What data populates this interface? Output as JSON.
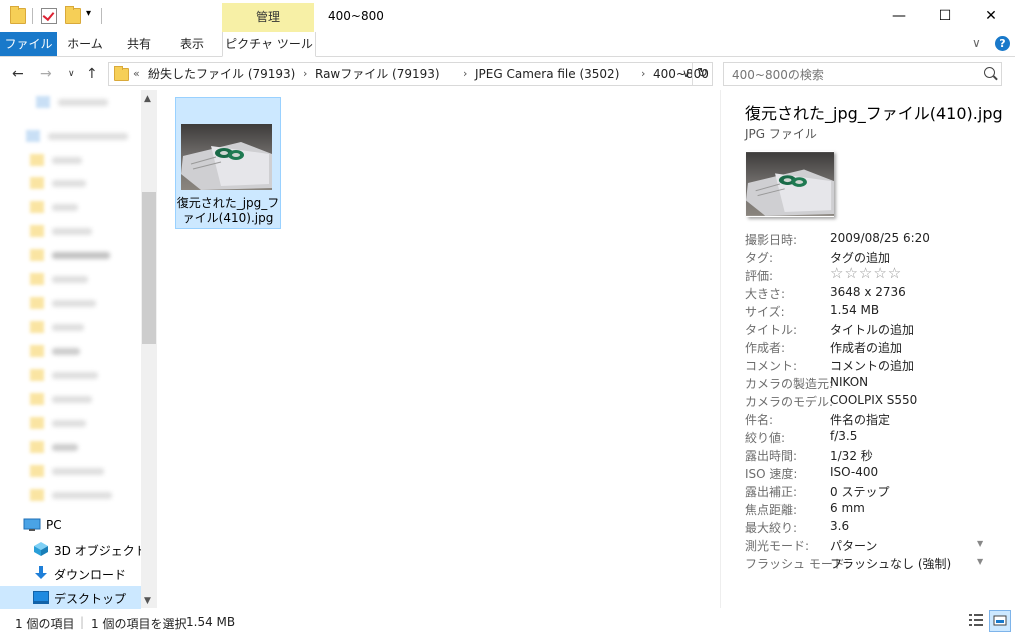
{
  "window": {
    "title": "400~800",
    "context_tab": "管理",
    "controls": {
      "minimize": "—",
      "maximize": "☐",
      "close": "✕"
    }
  },
  "ribbon": {
    "tabs": [
      "ファイル",
      "ホーム",
      "共有",
      "表示",
      "ピクチャ ツール"
    ]
  },
  "address": {
    "crumbs": [
      "紛失したファイル (79193)",
      "Rawファイル (79193)",
      "JPEG Camera file (3502)",
      "400~800"
    ]
  },
  "search": {
    "placeholder": "400~800の検索"
  },
  "nav": {
    "items": [
      {
        "label": "PC"
      },
      {
        "label": "3D オブジェクト"
      },
      {
        "label": "ダウンロード"
      },
      {
        "label": "デスクトップ"
      }
    ]
  },
  "content": {
    "file_label_line1": "復元された_jpg_フ",
    "file_label_line2": "ァイル(410).jpg"
  },
  "details": {
    "title": "復元された_jpg_ファイル(410).jpg",
    "type": "JPG ファイル",
    "rating_stars": "☆☆☆☆☆",
    "props": [
      {
        "key": "撮影日時:",
        "value": "2009/08/25 6:20"
      },
      {
        "key": "タグ:",
        "value": "タグの追加"
      },
      {
        "key": "評価:",
        "value": ""
      },
      {
        "key": "大きさ:",
        "value": "3648 x 2736"
      },
      {
        "key": "サイズ:",
        "value": "1.54 MB"
      },
      {
        "key": "タイトル:",
        "value": "タイトルの追加"
      },
      {
        "key": "作成者:",
        "value": "作成者の追加"
      },
      {
        "key": "コメント:",
        "value": "コメントの追加"
      },
      {
        "key": "カメラの製造元:",
        "value": "NIKON"
      },
      {
        "key": "カメラのモデル:",
        "value": "COOLPIX S550"
      },
      {
        "key": "件名:",
        "value": "件名の指定"
      },
      {
        "key": "絞り値:",
        "value": "f/3.5"
      },
      {
        "key": "露出時間:",
        "value": "1/32 秒"
      },
      {
        "key": "ISO 速度:",
        "value": "ISO-400"
      },
      {
        "key": "露出補正:",
        "value": "0 ステップ"
      },
      {
        "key": "焦点距離:",
        "value": "6 mm"
      },
      {
        "key": "最大絞り:",
        "value": "3.6"
      },
      {
        "key": "測光モード:",
        "value": "パターン"
      },
      {
        "key": "フラッシュ モード:",
        "value": "フラッシュなし (強制)"
      }
    ]
  },
  "status": {
    "count": "1 個の項目",
    "selected": "1 個の項目を選択",
    "size": "1.54 MB"
  },
  "colors": {
    "accent": "#1979ca",
    "selection": "#cce8ff",
    "context_tab": "#f7f0a6"
  }
}
